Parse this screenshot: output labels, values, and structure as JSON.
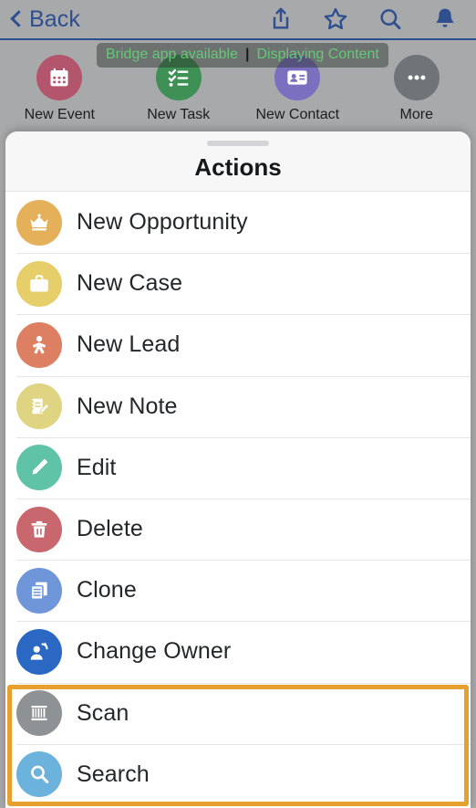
{
  "navbar": {
    "back_label": "Back",
    "icons": [
      {
        "name": "share-icon",
        "label": "Share"
      },
      {
        "name": "star-icon",
        "label": "Favorite"
      },
      {
        "name": "search-icon",
        "label": "Search"
      },
      {
        "name": "bell-icon",
        "label": "Notifications"
      }
    ],
    "accent_color": "#2f4f8f"
  },
  "toast": {
    "primary": "Bridge app available",
    "separator": "|",
    "secondary": "Displaying Content",
    "text_color": "#64c878"
  },
  "quick_actions": [
    {
      "label": "New Event",
      "icon": "calendar-icon",
      "color": "#b3566d"
    },
    {
      "label": "New Task",
      "icon": "checklist-icon",
      "color": "#3f9054"
    },
    {
      "label": "New Contact",
      "icon": "contact-card-icon",
      "color": "#7b6fc0"
    },
    {
      "label": "More",
      "icon": "ellipsis-icon",
      "color": "#6f7479"
    }
  ],
  "sheet": {
    "title": "Actions",
    "grabber": "drag-handle",
    "items": [
      {
        "label": "New Opportunity",
        "icon": "crown-icon",
        "color": "#e4b05a"
      },
      {
        "label": "New Case",
        "icon": "briefcase-icon",
        "color": "#e6ce6a"
      },
      {
        "label": "New Lead",
        "icon": "lead-person-icon",
        "color": "#dd7f62"
      },
      {
        "label": "New Note",
        "icon": "note-pencil-icon",
        "color": "#dfd481"
      },
      {
        "label": "Edit",
        "icon": "pencil-icon",
        "color": "#5fc3a8"
      },
      {
        "label": "Delete",
        "icon": "trash-icon",
        "color": "#c8686e"
      },
      {
        "label": "Clone",
        "icon": "copy-icon",
        "color": "#6f96d8"
      },
      {
        "label": "Change Owner",
        "icon": "change-owner-icon",
        "color": "#2a68c4"
      },
      {
        "label": "Scan",
        "icon": "barcode-icon",
        "color": "#8e9294"
      },
      {
        "label": "Search",
        "icon": "magnifier-icon",
        "color": "#6bb2dc"
      }
    ]
  },
  "highlight": {
    "name": "scan-search-highlight",
    "color": "#e5a02e"
  }
}
